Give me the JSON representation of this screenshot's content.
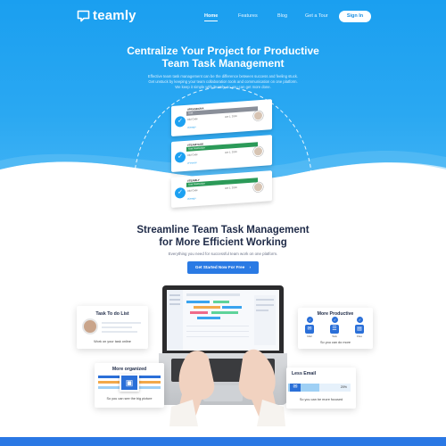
{
  "brand": {
    "name": "teamly"
  },
  "nav": {
    "items": [
      {
        "label": "Home",
        "active": true
      },
      {
        "label": "Features",
        "active": false
      },
      {
        "label": "Blog",
        "active": false
      },
      {
        "label": "Get a Tour",
        "active": false
      }
    ],
    "signin_label": "Sign In"
  },
  "hero": {
    "title_line1": "Centralize Your Project for Productive",
    "title_line2": "Team Task Management",
    "desc_line1": "Effective team task management can be the difference between success and feeling stuck.",
    "desc_line2": "Get unstuck by keeping your team collaboration tools and communication on one platform.",
    "desc_line3": "We keep it simple with Teamly, so you can get more done."
  },
  "task_cards": [
    {
      "title": "#PRASECHA",
      "bar_text": "Task",
      "bar_color": "#8a8f99",
      "meta": "Add Code",
      "date": "Jan 1, 2019",
      "tag": "#Design"
    },
    {
      "title": "#TEAMTASK",
      "bar_text": "Task Notification",
      "bar_color": "#2b9a58",
      "meta": "Add Code",
      "date": "Jan 1, 2019",
      "tag": "#Finance"
    },
    {
      "title": "#TEAMLY",
      "bar_text": "Task Notification",
      "bar_color": "#2b9a58",
      "meta": "Add Code",
      "date": "Jan 1, 2019",
      "tag": "#Design"
    }
  ],
  "section2": {
    "title_line1": "Streamline Team Task Management",
    "title_line2": "for More Efficient Working",
    "desc": "Everything you need for successful team work on one platform.",
    "cta_label": "Get Started Now For Free",
    "cta_arrow": "›"
  },
  "feature_cards": {
    "todo": {
      "title": "Task To do List",
      "sub": "Work on your task online"
    },
    "productive": {
      "title": "More Productive",
      "sub": "So you can do more",
      "icons": [
        {
          "label": "Mail",
          "icon": "mail-icon"
        },
        {
          "label": "Task",
          "icon": "task-icon"
        },
        {
          "label": "Files",
          "icon": "files-icon"
        }
      ]
    },
    "organized": {
      "title": "More organized",
      "sub": "So you can see the big picture"
    },
    "less_email": {
      "title": "Less Email",
      "progress_label": "20%",
      "progress": 0.2,
      "sub": "So you can be more focused"
    }
  },
  "colors": {
    "hero": "#1a9ff0",
    "accent": "#2a7ae4",
    "dark_text": "#1f2b48"
  }
}
